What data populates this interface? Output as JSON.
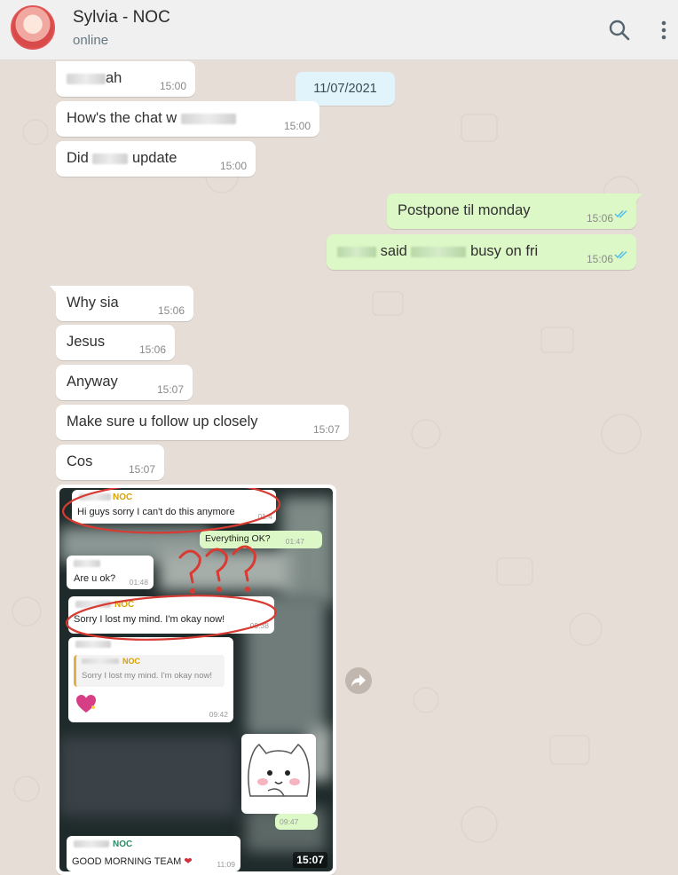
{
  "header": {
    "name": "Sylvia - NOC",
    "status": "online"
  },
  "date_chip": "11/07/2021",
  "messages": [
    {
      "dir": "in",
      "text_after": "ah",
      "time": "15:00"
    },
    {
      "dir": "in",
      "text": "How's the chat w",
      "time": "15:00"
    },
    {
      "dir": "in",
      "text_before": "Did",
      "text_after": "update",
      "time": "15:00"
    },
    {
      "dir": "out",
      "text": "Postpone til monday",
      "time": "15:06"
    },
    {
      "dir": "out",
      "text_mid": "said",
      "text_after": "busy on fri",
      "time": "15:06"
    },
    {
      "dir": "in",
      "text": "Why sia",
      "time": "15:06"
    },
    {
      "dir": "in",
      "text": "Jesus",
      "time": "15:06"
    },
    {
      "dir": "in",
      "text": "Anyway",
      "time": "15:07"
    },
    {
      "dir": "in",
      "text": "Make sure u follow up closely",
      "time": "15:07"
    },
    {
      "dir": "in",
      "text": "Cos",
      "time": "15:07"
    }
  ],
  "image_message": {
    "time": "15:07",
    "inner": {
      "noc1_name": "NOC",
      "noc1_text": "Hi guys sorry I can't do this anymore",
      "noc1_time": "01:4",
      "everything_ok": "Everything OK?",
      "everything_ok_time": "01:47",
      "are_u_ok": "Are u ok?",
      "are_u_ok_time": "01:48",
      "noc2_name": "NOC",
      "noc2_text": "Sorry I lost my mind. I'm okay now!",
      "noc2_time": "09:38",
      "reply_name": "NOC",
      "reply_text": "Sorry I lost my mind. I'm okay now!",
      "reply_time": "09:42",
      "sticker_time": "09:47",
      "noc3_name": "NOC",
      "noc3_text": "GOOD MORNING TEAM",
      "noc3_time": "11:09"
    }
  },
  "colors": {
    "incoming_bubble": "#ffffff",
    "outgoing_bubble": "#dcf8c6",
    "chat_background": "#e6ded6",
    "read_tick": "#53bdeb",
    "annotation_red": "#d93a32"
  },
  "icons": [
    "search-icon",
    "menu-icon",
    "double-check-icon",
    "forward-icon",
    "heart-emoji"
  ]
}
